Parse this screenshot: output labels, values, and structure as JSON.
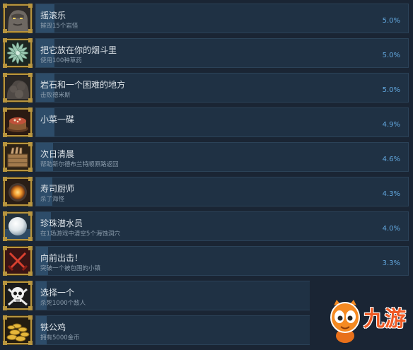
{
  "colors": {
    "page_bg": "#1a2534",
    "bar_bg": "#1f3144",
    "bar_border": "#2b4258",
    "fill": "#2d4c69",
    "title_text": "#dde3e8",
    "description_text": "#8a9bab",
    "percent_text": "#62a7de",
    "frame_gold": "#b8953e",
    "watermark_orange": "#f58a22",
    "watermark_text": "#ef5a24"
  },
  "achievements": [
    {
      "icon": "rock-golem-icon",
      "title": "摇滚乐",
      "description": "摧毁15个岩怪",
      "percent_label": "5.0%",
      "fill_percent": 5.0
    },
    {
      "icon": "herb-icon",
      "title": "把它放在你的烟斗里",
      "description": "使用100种草药",
      "percent_label": "5.0%",
      "fill_percent": 5.0
    },
    {
      "icon": "rock-icon",
      "title": "岩石和一个困难的地方",
      "description": "击败德米斯",
      "percent_label": "5.0%",
      "fill_percent": 5.0
    },
    {
      "icon": "dish-icon",
      "title": "小菜一碟",
      "percent_label": "4.9%",
      "fill_percent": 4.9
    },
    {
      "icon": "crate-icon",
      "title": "次日清晨",
      "description": "帮助新尔德布兰特顺原路返回",
      "percent_label": "4.6%",
      "fill_percent": 4.6
    },
    {
      "icon": "fire-pot-icon",
      "title": "寿司厨师",
      "description": "杀了海怪",
      "percent_label": "4.3%",
      "fill_percent": 4.3
    },
    {
      "icon": "pearl-icon",
      "title": "珍珠潜水员",
      "description": "在1场游戏中清空5个海蚀洞穴",
      "percent_label": "4.0%",
      "fill_percent": 4.0
    },
    {
      "icon": "crossed-swords-icon",
      "title": "向前出击！",
      "description": "突破一个被包围的小镇",
      "percent_label": "3.3%",
      "fill_percent": 3.3
    },
    {
      "icon": "skull-icon",
      "title": "选择一个",
      "description": "杀死1000个敌人",
      "fill_percent": 2.8
    },
    {
      "icon": "gold-coins-icon",
      "title": "铁公鸡",
      "description": "拥有5000金币",
      "fill_percent": 2.8
    }
  ],
  "watermark": {
    "icon": "mascot-icon",
    "text": "九游"
  }
}
